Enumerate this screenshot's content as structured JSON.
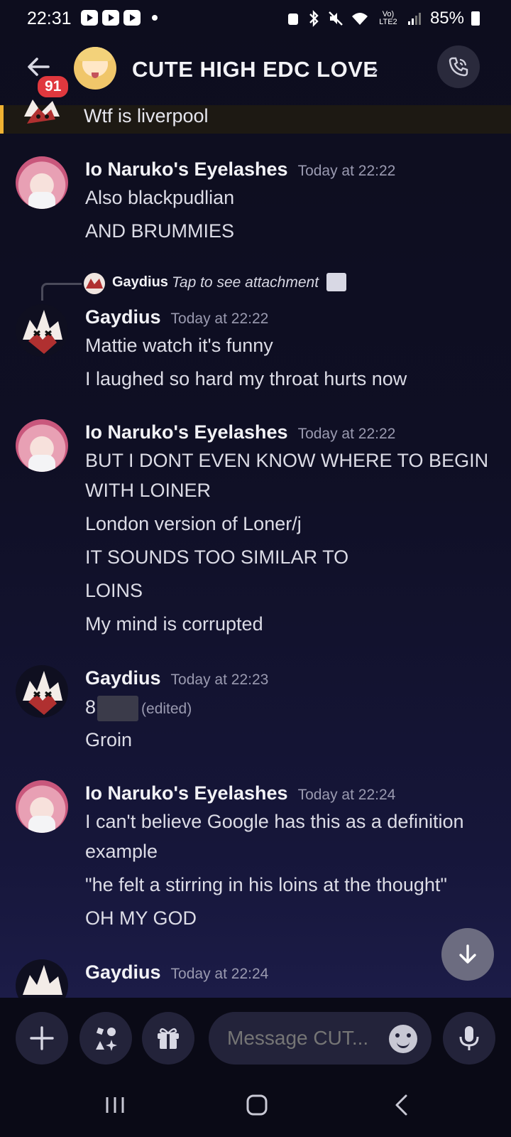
{
  "status_bar": {
    "time": "22:31",
    "network_label": "Vo) LTE2",
    "battery": "85%"
  },
  "header": {
    "unread_count": "91",
    "server_name": "CUTE HIGH EDC LOVE",
    "chevron": "›"
  },
  "pinned_preview": {
    "text": "Wtf is liverpool",
    "accent": "#f0b232"
  },
  "messages": [
    {
      "author": "Io Naruko's Eyelashes",
      "timestamp": "Today at 22:22",
      "lines": [
        "Also blackpudlian",
        "AND BRUMMIES"
      ]
    },
    {
      "reply": {
        "author": "Gaydius",
        "text": "Tap to see attachment",
        "icon": "image-icon"
      },
      "author": "Gaydius",
      "timestamp": "Today at 22:22",
      "lines": [
        "Mattie watch it's funny",
        "I laughed so hard my throat hurts now"
      ]
    },
    {
      "author": "Io Naruko's Eyelashes",
      "timestamp": "Today at 22:22",
      "lines": [
        "BUT I DONT EVEN KNOW WHERE TO BEGIN",
        "WITH LOINER",
        "London version of Loner/j",
        "IT SOUNDS TOO SIMILAR TO",
        "LOINS",
        "My mind is corrupted"
      ]
    },
    {
      "author": "Gaydius",
      "timestamp": "Today at 22:23",
      "lines": [
        "8",
        "(edited)",
        "Groin"
      ]
    },
    {
      "author": "Io Naruko's Eyelashes",
      "timestamp": "Today at 22:24",
      "lines": [
        "I can't believe Google has this as a definition",
        "example",
        "\"he felt a stirring in his loins at the thought\"",
        "OH MY GOD"
      ]
    },
    {
      "author": "Gaydius",
      "timestamp": "Today at 22:24"
    }
  ],
  "composer": {
    "placeholder": "Message CUT..."
  },
  "colors": {
    "badge": "#e0383e",
    "pinned_accent": "#f0b232",
    "background": "#0d0d1e"
  }
}
